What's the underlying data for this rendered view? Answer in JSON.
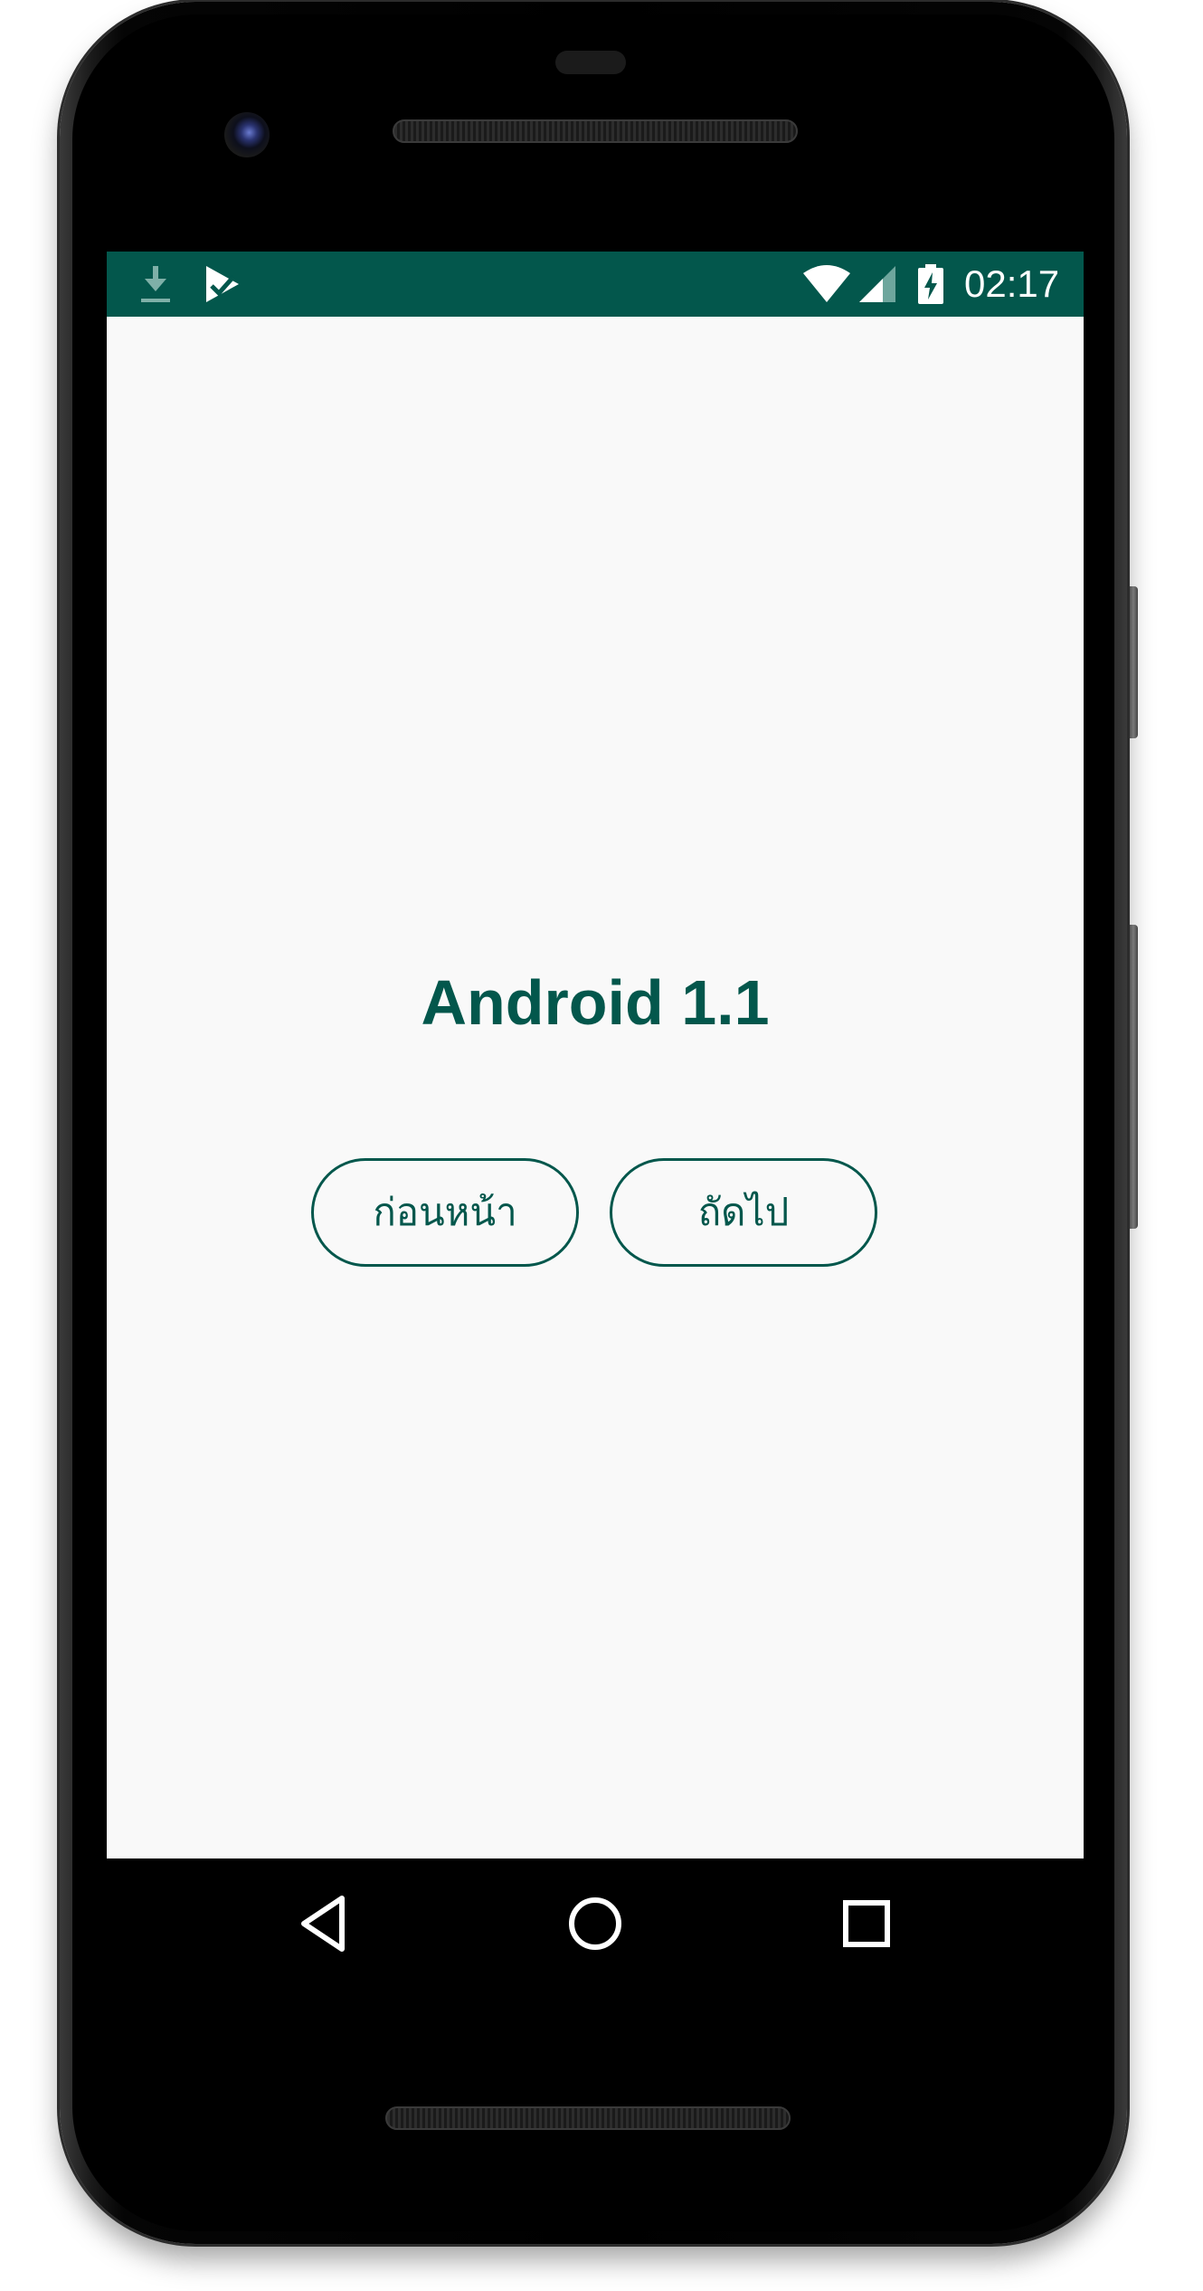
{
  "status_bar": {
    "time": "02:17",
    "background_color": "#03574c",
    "left_icons": [
      "download-icon",
      "task-check-icon"
    ],
    "right_icons": [
      "wifi-icon",
      "cell-signal-icon",
      "battery-charging-icon"
    ]
  },
  "screen": {
    "background_color": "#f9f9f9",
    "title": "Android 1.1",
    "accent_color": "#03574c",
    "buttons": {
      "previous_label": "ก่อนหน้า",
      "next_label": "ถัดไป"
    }
  },
  "nav_bar": {
    "icons": [
      "back-icon",
      "home-icon",
      "recents-icon"
    ]
  }
}
